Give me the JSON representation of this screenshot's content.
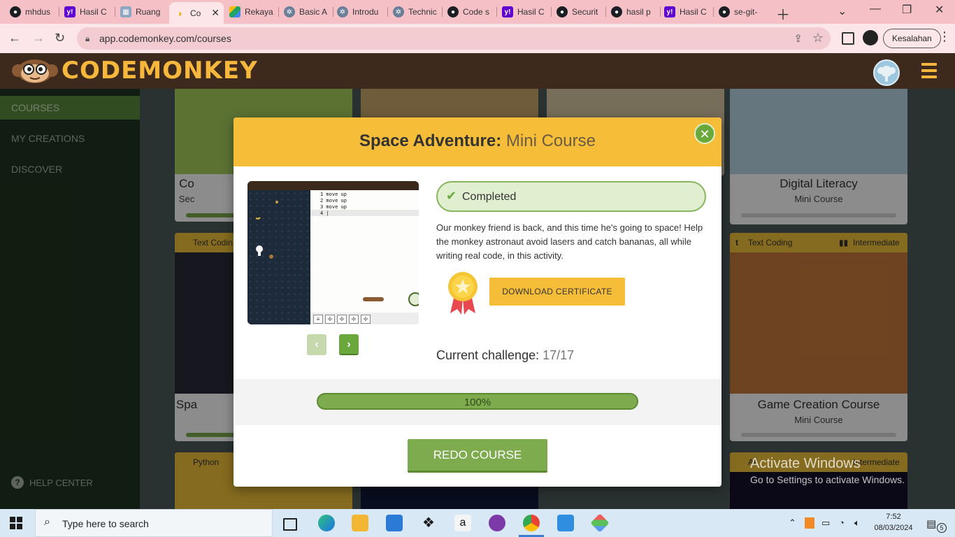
{
  "browser": {
    "tabs": [
      {
        "label": "mhdus",
        "icon": "github-icon",
        "color": "#1b1f23"
      },
      {
        "label": "Hasil C",
        "icon": "yahoo-icon",
        "color": "#5f01d1"
      },
      {
        "label": "Ruang",
        "icon": "ruang-icon",
        "color": "#8da6c2"
      },
      {
        "label": "Co",
        "icon": "banana-icon",
        "color": "#e9b400",
        "active": true
      },
      {
        "label": "Rekaya",
        "icon": "drive-icon",
        "color": "#1fa463"
      },
      {
        "label": "Basic A",
        "icon": "settings-icon",
        "color": "#6b7f99"
      },
      {
        "label": "Introdu",
        "icon": "settings-icon",
        "color": "#6b7f99"
      },
      {
        "label": "Technic",
        "icon": "settings-icon",
        "color": "#6b7f99"
      },
      {
        "label": "Code s",
        "icon": "github-icon",
        "color": "#1b1f23"
      },
      {
        "label": "Hasil C",
        "icon": "yahoo-icon",
        "color": "#5f01d1"
      },
      {
        "label": "Securit",
        "icon": "github-icon",
        "color": "#1b1f23"
      },
      {
        "label": "hasil p",
        "icon": "github-icon",
        "color": "#1b1f23"
      },
      {
        "label": "Hasil C",
        "icon": "yahoo-icon",
        "color": "#5f01d1"
      },
      {
        "label": "se-git-",
        "icon": "github-icon",
        "color": "#1b1f23"
      }
    ],
    "url": "app.codemonkey.com/courses",
    "profile_button": "Kesalahan"
  },
  "header": {
    "logo_text": "CODEMONKEY"
  },
  "sidebar": {
    "items": [
      {
        "label": "COURSES",
        "active": true
      },
      {
        "label": "MY CREATIONS"
      },
      {
        "label": "DISCOVER"
      }
    ],
    "help": "HELP CENTER"
  },
  "cards": {
    "c1": {
      "title": "Co",
      "sub": "Sec"
    },
    "c2": {
      "title": "Digital Literacy",
      "sub": "Mini Course"
    },
    "c3": {
      "tag": "Text Codin",
      "title": "Spa"
    },
    "c4": {
      "tag": "Text Coding",
      "level": "Intermediate",
      "title": "Game Creation Course",
      "sub": "Mini Course"
    },
    "c5": {
      "tag": "Python"
    },
    "c6": {
      "tag": "AI",
      "level": "Intermediate"
    }
  },
  "modal": {
    "title_bold": "Space Adventure:",
    "title_thin": "Mini Course",
    "close": "✕",
    "code_lines": "1 move up\n2 move up\n3 move up\n4 |",
    "status": "Completed",
    "description": "Our monkey friend is back, and this time he's going to space! Help the monkey astronaut avoid lasers and catch bananas, all while writing real code, in this activity.",
    "download": "DOWNLOAD CERTIFICATE",
    "challenge_label": "Current challenge:",
    "challenge_value": "17/17",
    "progress_text": "100%",
    "progress": 1.0,
    "redo": "REDO COURSE"
  },
  "watermark": {
    "line1": "Activate Windows",
    "line2": "Go to Settings to activate Windows."
  },
  "taskbar": {
    "search_placeholder": "Type here to search",
    "time": "7:52",
    "date": "08/03/2024",
    "notifications": "5"
  }
}
